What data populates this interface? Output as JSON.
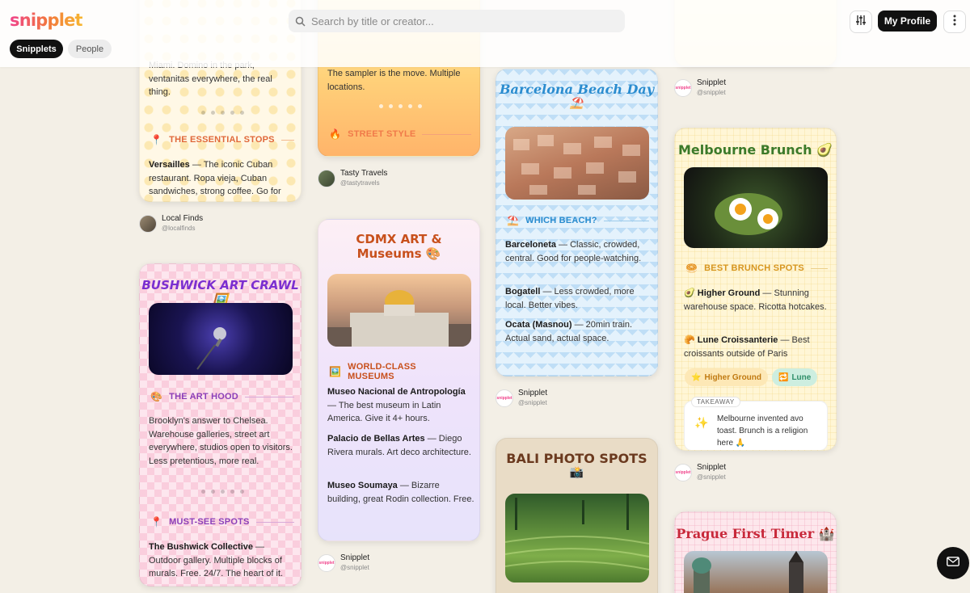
{
  "app": {
    "logo": "snipplet"
  },
  "nav": {
    "tabs": [
      {
        "label": "Snipplets"
      },
      {
        "label": "People"
      }
    ]
  },
  "search": {
    "placeholder": "Search by title or creator..."
  },
  "header": {
    "profile_label": "My Profile"
  },
  "cards": {
    "havana": {
      "text1": "Miami. Domino in the park, ventanitas everywhere, the real thing.",
      "section": "THE ESSENTIAL STOPS",
      "item_title": "Versailles",
      "item_text": " — The iconic Cuban restaurant. Ropa vieja, Cuban sandwiches, strong coffee. Go for"
    },
    "street": {
      "text1": "The sampler is the move. Multiple locations.",
      "section": "STREET STYLE"
    },
    "bushwick": {
      "title": "BUSHWICK ART CRAWL 🖼️",
      "section1": "THE ART HOOD",
      "text1": "Brooklyn's answer to Chelsea. Warehouse galleries, street art everywhere, studios open to visitors. Less pretentious, more real.",
      "section2": "MUST-SEE SPOTS",
      "item_title": "The Bushwick Collective",
      "item_text": " — Outdoor gallery. Multiple blocks of murals. Free. 24/7. The heart of it."
    },
    "cdmx": {
      "title_line1": "CDMX ART &",
      "title_line2": "Museums 🎨",
      "section": "WORLD-CLASS MUSEUMS",
      "items": [
        {
          "title": "Museo Nacional de Antropología",
          "text": " — The best museum in Latin America. Give it 4+ hours."
        },
        {
          "title": "Palacio de Bellas Artes",
          "text": " — Diego Rivera murals. Art deco architecture."
        },
        {
          "title": "Museo Soumaya",
          "text": " — Bizarre building, great Rodin collection. Free."
        }
      ]
    },
    "barcelona": {
      "title_line1": "Barcelona Beach Day",
      "title_line2": "⛱️",
      "section": "WHICH BEACH?",
      "items": [
        {
          "title": "Barceloneta",
          "text": " — Classic, crowded, central. Good for people-watching."
        },
        {
          "title": "Bogatell",
          "text": " — Less crowded, more local. Better vibes."
        },
        {
          "title": "Ocata (Masnou)",
          "text": " — 20min train. Actual sand, actual space."
        }
      ]
    },
    "bali": {
      "title_line1": "BALI PHOTO SPOTS",
      "title_line2": "📸"
    },
    "melbourne": {
      "title": "Melbourne Brunch 🥑",
      "section": "BEST BRUNCH SPOTS",
      "items": [
        {
          "title": "Higher Ground",
          "text": " — Stunning warehouse space. Ricotta hotcakes."
        },
        {
          "title": "Lune Croissanterie",
          "text": " — Best croissants outside of Paris"
        }
      ],
      "pills": [
        "Higher Ground",
        "Lune"
      ],
      "takeaway_label": "TAKEAWAY",
      "takeaway_text": "Melbourne invented avo toast. Brunch is a religion here 🙏"
    },
    "prague": {
      "title": "Prague First Timer 🏰"
    }
  },
  "creators": {
    "local_finds": {
      "name": "Local Finds",
      "handle": "@localfinds"
    },
    "tasty_travels": {
      "name": "Tasty Travels",
      "handle": "@tastytravels"
    },
    "snipplet": {
      "name": "Snipplet",
      "handle": "@snipplet"
    }
  }
}
